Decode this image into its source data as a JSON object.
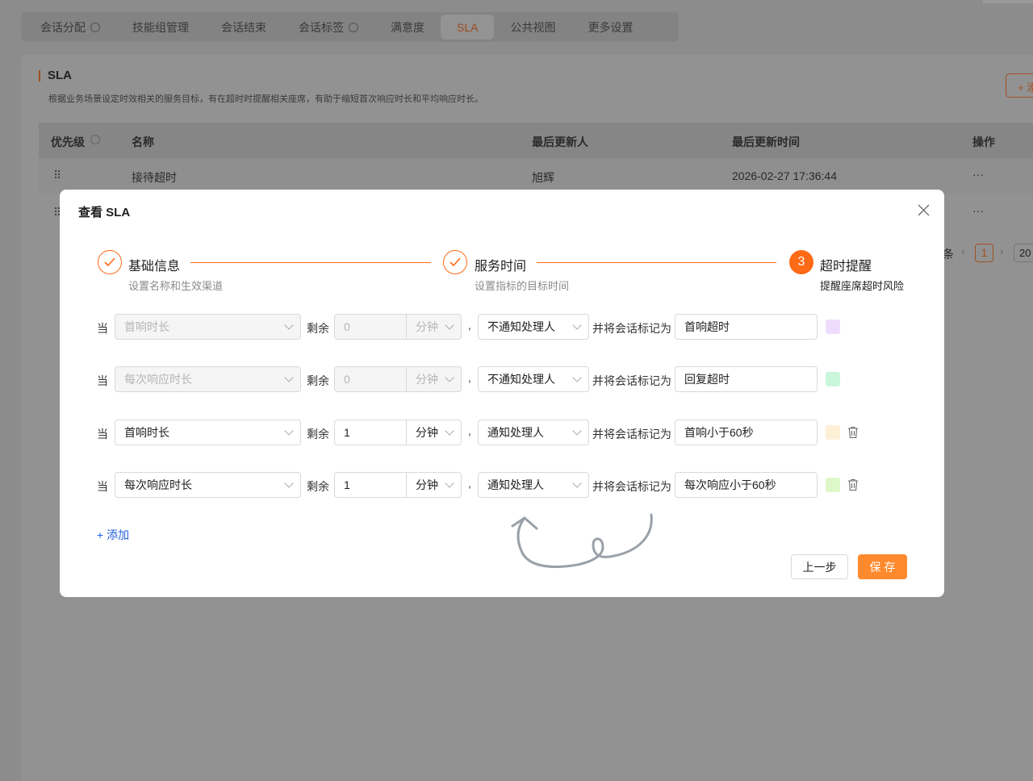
{
  "tabs": [
    {
      "label": "会话分配",
      "info": true
    },
    {
      "label": "技能组管理"
    },
    {
      "label": "会话结束"
    },
    {
      "label": "会话标签",
      "help": true
    },
    {
      "label": "满意度"
    },
    {
      "label": "SLA",
      "active": true
    },
    {
      "label": "公共视图"
    },
    {
      "label": "更多设置"
    }
  ],
  "page": {
    "title": "SLA",
    "description": "根据业务场景设定时效相关的服务目标，有在超时时提醒相关座席，有助于缩短首次响应时长和平均响应时长。",
    "add_button": "+ 添"
  },
  "table": {
    "columns": [
      "优先级",
      "名称",
      "最后更新人",
      "最后更新时间",
      "操作"
    ],
    "rows": [
      {
        "name": "接待超时",
        "updater": "旭辉",
        "time": "2026-02-27 17:36:44",
        "action": "···"
      },
      {
        "action": "···"
      }
    ]
  },
  "pagination": {
    "current": "1",
    "page_size": "20",
    "prefix": "条"
  },
  "modal": {
    "title": "查看 SLA",
    "steps": [
      {
        "title": "基础信息",
        "desc": "设置名称和生效渠道",
        "status": "done"
      },
      {
        "title": "服务时间",
        "desc": "设置指标的目标时间",
        "status": "done"
      },
      {
        "number": "3",
        "title": "超时提醒",
        "desc": "提醒座席超时风险",
        "status": "current"
      }
    ],
    "labels": {
      "when": "当",
      "remaining": "剩余",
      "comma": ",",
      "mark_as": "并将会话标记为"
    },
    "rules": [
      {
        "metric": "首响时长",
        "value": "0",
        "unit": "分钟",
        "notify": "不通知处理人",
        "tag": "首响超时",
        "color": "#efdcfd",
        "disabled": true,
        "deletable": false
      },
      {
        "metric": "每次响应时长",
        "value": "0",
        "unit": "分钟",
        "notify": "不通知处理人",
        "tag": "回复超时",
        "color": "#c9f7dc",
        "disabled": true,
        "deletable": false
      },
      {
        "metric": "首响时长",
        "value": "1",
        "unit": "分钟",
        "notify": "通知处理人",
        "tag": "首响小于60秒",
        "color": "#fdf0d6",
        "disabled": false,
        "deletable": true
      },
      {
        "metric": "每次响应时长",
        "value": "1",
        "unit": "分钟",
        "notify": "通知处理人",
        "tag": "每次响应小于60秒",
        "color": "#def7c8",
        "disabled": false,
        "deletable": true
      }
    ],
    "add_link": "+ 添加",
    "prev_button": "上一步",
    "save_button": "保 存"
  }
}
